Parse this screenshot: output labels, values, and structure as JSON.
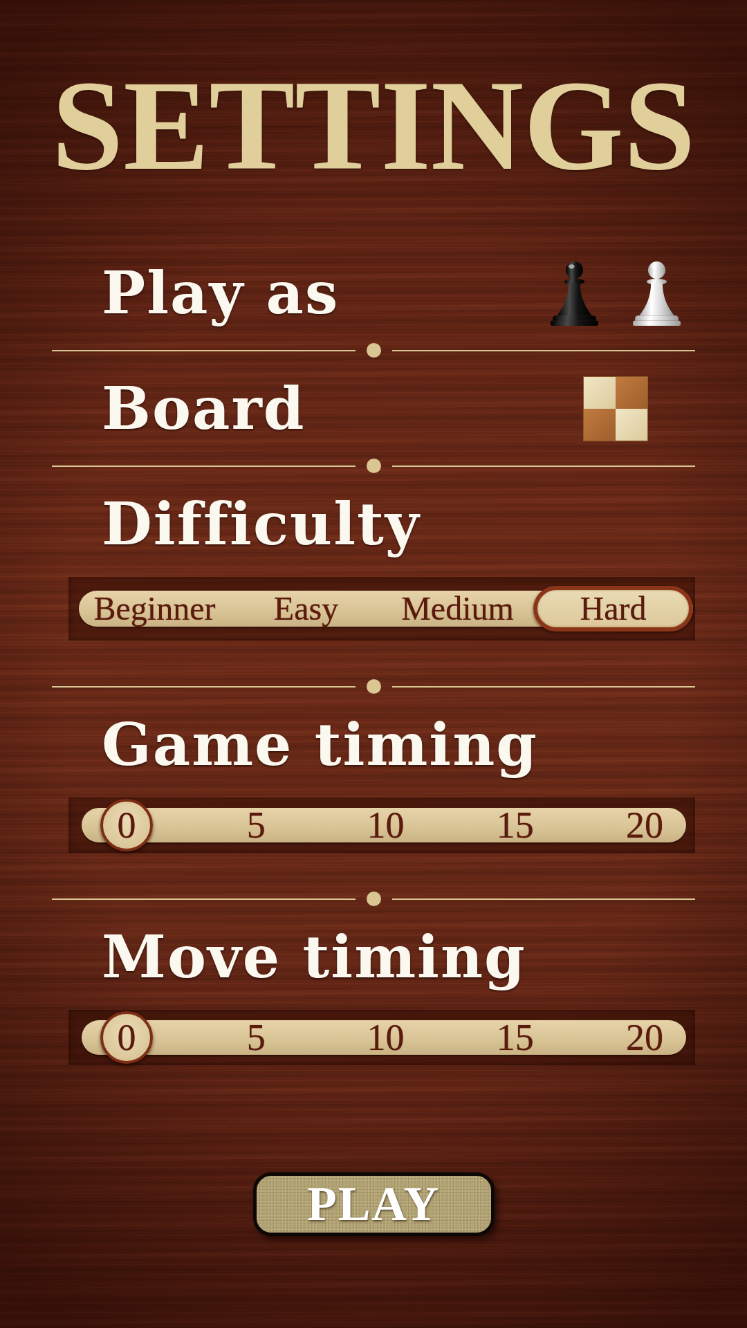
{
  "title": "SETTINGS",
  "sections": [
    {
      "kind": "pieces",
      "label": "Play as"
    },
    {
      "kind": "board",
      "label": "Board"
    },
    {
      "kind": "segmented",
      "label": "Difficulty",
      "options": [
        {
          "label": "Beginner",
          "selected": false
        },
        {
          "label": "Easy",
          "selected": false
        },
        {
          "label": "Medium",
          "selected": false
        },
        {
          "label": "Hard",
          "selected": true
        }
      ]
    },
    {
      "kind": "slider",
      "label": "Game timing",
      "level": 0,
      "ticks": [
        "0",
        "5",
        "10",
        "15",
        "20"
      ]
    },
    {
      "kind": "slider",
      "label": "Move timing",
      "level": 0,
      "ticks": [
        "0",
        "5",
        "10",
        "15",
        "20"
      ]
    }
  ],
  "play_button": "PLAY"
}
